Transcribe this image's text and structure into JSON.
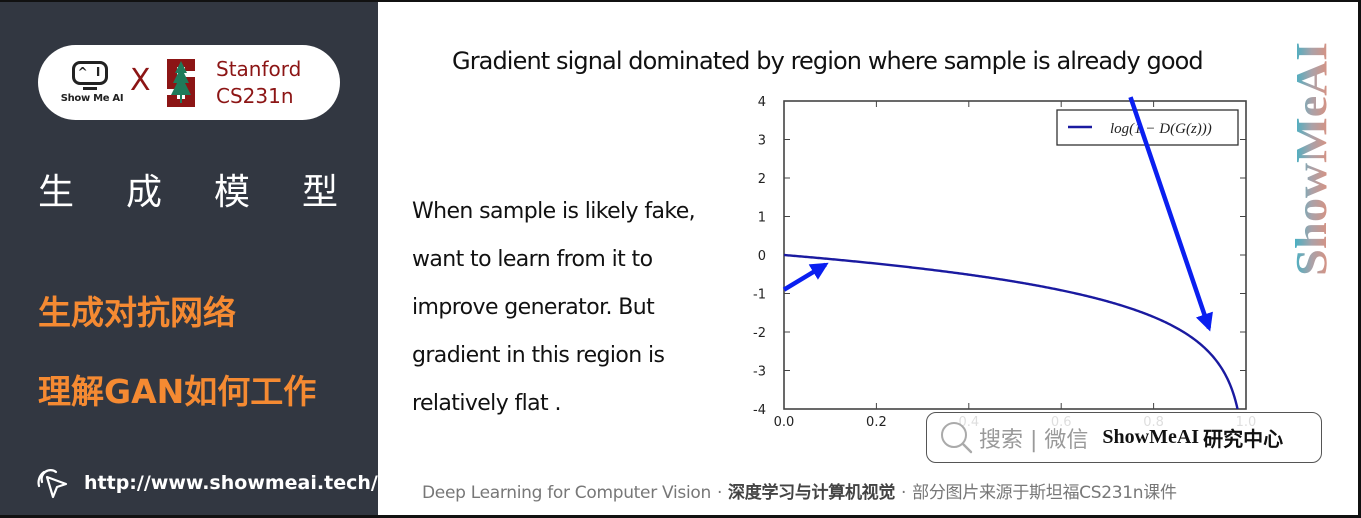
{
  "sidebar": {
    "logo_text": "Show Me AI",
    "logo_face": "^ I",
    "cross": "X",
    "stanford_line1": "Stanford",
    "stanford_line2": "CS231n",
    "section_title_chars": [
      "生",
      "成",
      "模",
      "型"
    ],
    "topic1": "生成对抗网络",
    "topic2": "理解GAN如何工作",
    "url": "http://www.showmeai.tech/"
  },
  "slide": {
    "title": "Gradient signal dominated by region where sample is already good",
    "body_lines": [
      "When sample is likely fake,",
      "want to learn from it to",
      "improve generator. But",
      "gradient in this region is",
      "relatively flat ."
    ]
  },
  "brand_vertical": "ShowMeAI",
  "search_box": {
    "gray_text": "搜索 | 微信",
    "brand": "ShowMeAI",
    "suffix": "研究中心"
  },
  "footer": {
    "part1": "Deep Learning for Computer Vision",
    "sep": "·",
    "part2": "深度学习与计算机视觉",
    "part3": "部分图片来源于斯坦福CS231n课件"
  },
  "colors": {
    "sidebar_bg": "#323741",
    "accent_orange": "#f58a32",
    "stanford_red": "#8c1515",
    "curve_blue": "#1a1aa0",
    "arrow_blue": "#0a1ff0"
  },
  "chart_data": {
    "type": "line",
    "title": "",
    "xlabel": "",
    "ylabel": "",
    "xlim": [
      0.0,
      1.0
    ],
    "ylim": [
      -4,
      4
    ],
    "xticks": [
      "0.0",
      "0.2",
      "0.4",
      "0.6",
      "0.8",
      "1.0"
    ],
    "yticks": [
      "4",
      "3",
      "2",
      "1",
      "0",
      "-1",
      "-2",
      "-3",
      "-4"
    ],
    "grid": false,
    "legend": {
      "position": "top-right",
      "entries": [
        "log(1 − D(G(z)))"
      ]
    },
    "series": [
      {
        "name": "log(1 − D(G(z)))",
        "function": "log(1 - x)",
        "x": [
          0.0,
          0.1,
          0.2,
          0.3,
          0.4,
          0.5,
          0.6,
          0.7,
          0.8,
          0.9,
          0.95,
          0.98
        ],
        "y": [
          0.0,
          -0.11,
          -0.22,
          -0.36,
          -0.51,
          -0.69,
          -0.92,
          -1.2,
          -1.61,
          -2.3,
          -3.0,
          -3.91
        ]
      }
    ],
    "annotations": [
      {
        "type": "arrow",
        "from": [
          0.0,
          -0.9
        ],
        "to": [
          0.09,
          -0.25
        ],
        "meaning": "flat region near x=0"
      },
      {
        "type": "arrow",
        "from": [
          0.75,
          4.1
        ],
        "to": [
          0.92,
          -1.9
        ],
        "meaning": "steep region near x=1"
      }
    ]
  }
}
